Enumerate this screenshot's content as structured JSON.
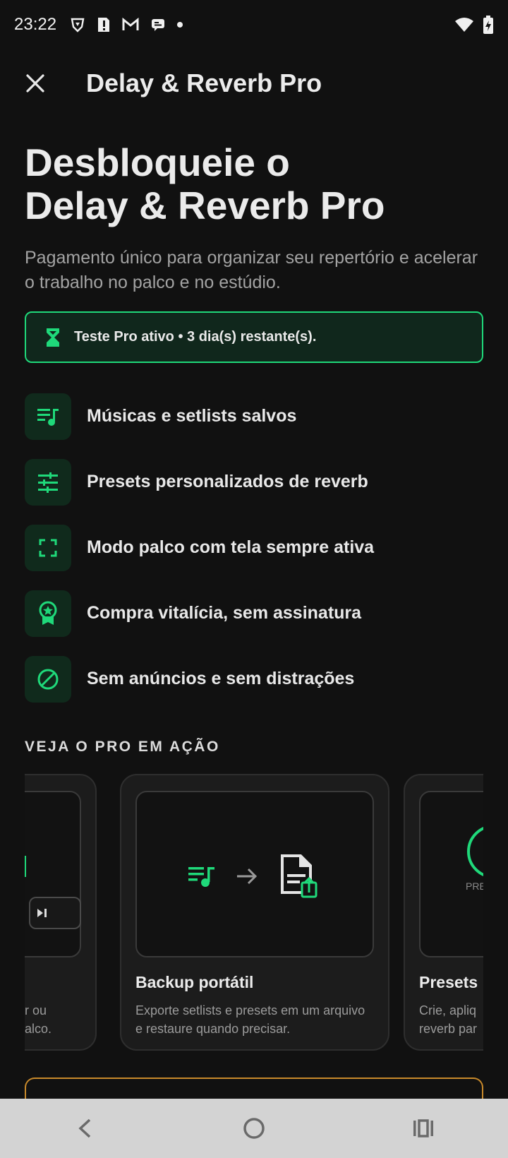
{
  "status_bar": {
    "time": "23:22"
  },
  "app_bar": {
    "title": "Delay & Reverb Pro"
  },
  "hero": {
    "title_line1": "Desbloqueie o",
    "title_line2": "Delay & Reverb Pro",
    "subtitle": "Pagamento único para organizar seu repertório e acelerar o trabalho no palco e no estúdio."
  },
  "trial": {
    "text": "Teste Pro ativo • 3 dia(s) restante(s)."
  },
  "features": [
    {
      "icon": "playlist-music-icon",
      "label": "Músicas e setlists salvos"
    },
    {
      "icon": "tune-sliders-icon",
      "label": "Presets personalizados de reverb"
    },
    {
      "icon": "fullscreen-icon",
      "label": "Modo palco com tela sempre ativa"
    },
    {
      "icon": "award-badge-icon",
      "label": "Compra vitalícia, sem assinatura"
    },
    {
      "icon": "block-icon",
      "label": "Sem anúncios e sem distrações"
    }
  ],
  "section": {
    "title": "VEJA O PRO EM AÇÃO"
  },
  "carousel": {
    "cards": [
      {
        "title": "",
        "desc_line1": "or ou",
        "desc_line2": "palco."
      },
      {
        "title": "Backup portátil",
        "desc": "Exporte setlists e presets em um arquivo e restaure quando precisar."
      },
      {
        "title": "Presets",
        "desc_line1": "Crie, apliq",
        "desc_line2": "reverb par",
        "preview_text": "PRE"
      }
    ]
  },
  "colors": {
    "accent": "#1fd97a",
    "background": "#111111",
    "nav": "#d3d3d3",
    "gold": "#c98a2b"
  }
}
